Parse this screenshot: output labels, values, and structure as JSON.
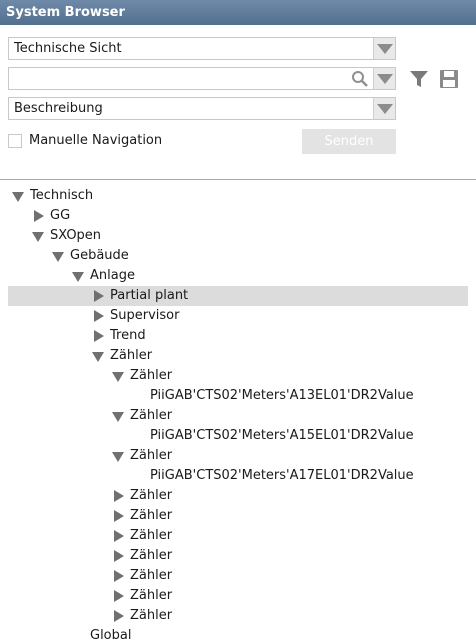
{
  "window": {
    "title": "System Browser"
  },
  "view_select": {
    "value": "Technische Sicht"
  },
  "search": {
    "value": ""
  },
  "filter_select": {
    "value": "Beschreibung"
  },
  "manual_nav": {
    "label": "Manuelle Navigation",
    "checked": false
  },
  "send_button": {
    "label": "Senden"
  },
  "icons": {
    "search": "search-icon",
    "filter": "filter-icon",
    "save": "save-icon",
    "dropdown": "chevron-down-icon"
  },
  "colors": {
    "titlebar": "#5f7c9c",
    "selection": "#dcdcdc",
    "arrow": "#707070"
  },
  "tree": {
    "nodes": [
      {
        "label": "Technisch",
        "state": "expanded",
        "depth": 0
      },
      {
        "label": "GG",
        "state": "collapsed",
        "depth": 1
      },
      {
        "label": "SXOpen",
        "state": "expanded",
        "depth": 1
      },
      {
        "label": "Gebäude",
        "state": "expanded",
        "depth": 2
      },
      {
        "label": "Anlage",
        "state": "expanded",
        "depth": 3
      },
      {
        "label": "Partial plant",
        "state": "collapsed",
        "depth": 4,
        "selected": true
      },
      {
        "label": "Supervisor",
        "state": "collapsed",
        "depth": 4
      },
      {
        "label": "Trend",
        "state": "collapsed",
        "depth": 4
      },
      {
        "label": "Zähler",
        "state": "expanded",
        "depth": 4
      },
      {
        "label": "Zähler",
        "state": "expanded",
        "depth": 5
      },
      {
        "label": "PiiGAB'CTS02'Meters'A13EL01'DR2Value",
        "state": "leaf",
        "depth": 6
      },
      {
        "label": "Zähler",
        "state": "expanded",
        "depth": 5
      },
      {
        "label": "PiiGAB'CTS02'Meters'A15EL01'DR2Value",
        "state": "leaf",
        "depth": 6
      },
      {
        "label": "Zähler",
        "state": "expanded",
        "depth": 5
      },
      {
        "label": "PiiGAB'CTS02'Meters'A17EL01'DR2Value",
        "state": "leaf",
        "depth": 6
      },
      {
        "label": "Zähler",
        "state": "collapsed",
        "depth": 5
      },
      {
        "label": "Zähler",
        "state": "collapsed",
        "depth": 5
      },
      {
        "label": "Zähler",
        "state": "collapsed",
        "depth": 5
      },
      {
        "label": "Zähler",
        "state": "collapsed",
        "depth": 5
      },
      {
        "label": "Zähler",
        "state": "collapsed",
        "depth": 5
      },
      {
        "label": "Zähler",
        "state": "collapsed",
        "depth": 5
      },
      {
        "label": "Zähler",
        "state": "collapsed",
        "depth": 5
      },
      {
        "label": "Global",
        "state": "leaf",
        "depth": 3
      }
    ]
  }
}
